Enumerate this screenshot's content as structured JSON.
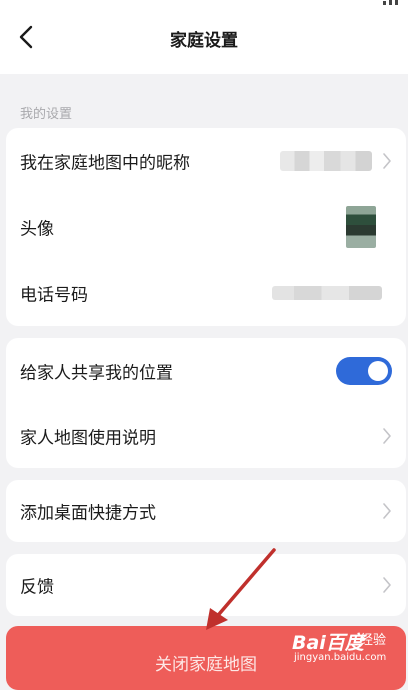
{
  "header": {
    "title": "家庭设置"
  },
  "section": {
    "label": "我的设置"
  },
  "settings": {
    "nickname_label": "我在家庭地图中的昵称",
    "avatar_label": "头像",
    "phone_label": "电话号码",
    "share_location_label": "给家人共享我的位置",
    "share_location_enabled": true,
    "guide_label": "家人地图使用说明",
    "shortcut_label": "添加桌面快捷方式",
    "feedback_label": "反馈"
  },
  "actions": {
    "close_label": "关闭家庭地图"
  },
  "watermark": {
    "brand": "Bai百度",
    "jingyan": "经验",
    "url": "jingyan.baidu.com"
  },
  "colors": {
    "toggle_on": "#2f6ad9",
    "close_button": "#ee5d59",
    "arrow": "#c0302c"
  },
  "icons": {
    "back": "back-arrow-icon",
    "chevron": "chevron-right-icon"
  }
}
